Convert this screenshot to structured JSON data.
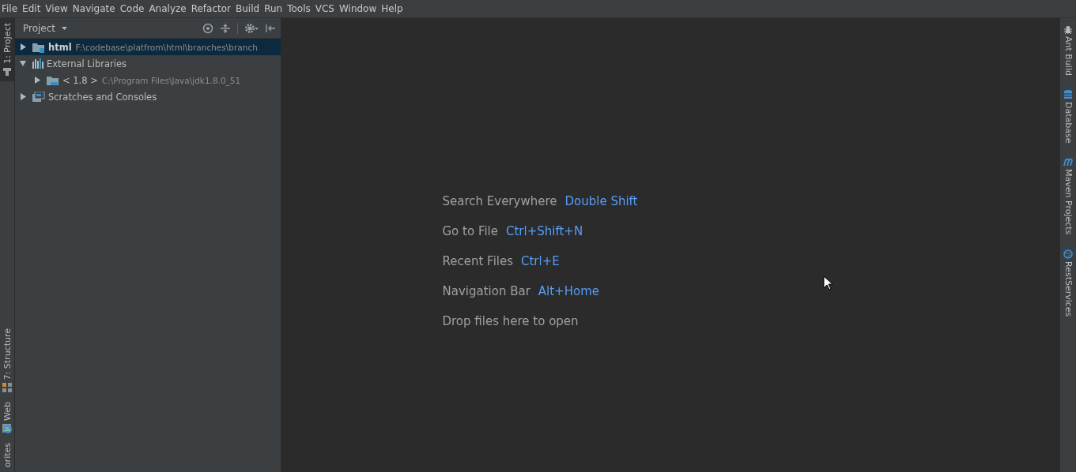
{
  "menu": [
    "File",
    "Edit",
    "View",
    "Navigate",
    "Code",
    "Analyze",
    "Refactor",
    "Build",
    "Run",
    "Tools",
    "VCS",
    "Window",
    "Help"
  ],
  "left_stripe": {
    "top": [
      {
        "label": "1: Project",
        "kind": "project",
        "selected": true
      }
    ],
    "bottom": [
      {
        "label": "7: Structure",
        "kind": "structure",
        "selected": false
      },
      {
        "label": "Web",
        "kind": "web",
        "selected": false
      },
      {
        "label": "orites",
        "kind": "plain",
        "selected": false
      }
    ]
  },
  "project_panel": {
    "title": "Project",
    "tree": [
      {
        "label": "html",
        "detail": "F:\\codebase\\platfrom\\html\\branches\\branch",
        "kind": "module",
        "expanded": false,
        "selected": true
      },
      {
        "label": "External Libraries",
        "kind": "libraries",
        "expanded": true,
        "selected": false,
        "children": [
          {
            "label": "< 1.8 >",
            "detail": "C:\\Program Files\\Java\\jdk1.8.0_51",
            "kind": "jdk",
            "expanded": false,
            "selected": false
          }
        ]
      },
      {
        "label": "Scratches and Consoles",
        "kind": "scratches",
        "expanded": false,
        "selected": false
      }
    ]
  },
  "editor": {
    "hints": [
      {
        "action": "Search Everywhere",
        "shortcut": "Double Shift"
      },
      {
        "action": "Go to File",
        "shortcut": "Ctrl+Shift+N"
      },
      {
        "action": "Recent Files",
        "shortcut": "Ctrl+E"
      },
      {
        "action": "Navigation Bar",
        "shortcut": "Alt+Home"
      },
      {
        "action": "Drop files here to open"
      }
    ]
  },
  "right_stripe": [
    {
      "label": "Ant Build",
      "kind": "ant"
    },
    {
      "label": "Database",
      "kind": "database"
    },
    {
      "label": "Maven Projects",
      "kind": "maven"
    },
    {
      "label": "RestServices",
      "kind": "globe"
    }
  ]
}
